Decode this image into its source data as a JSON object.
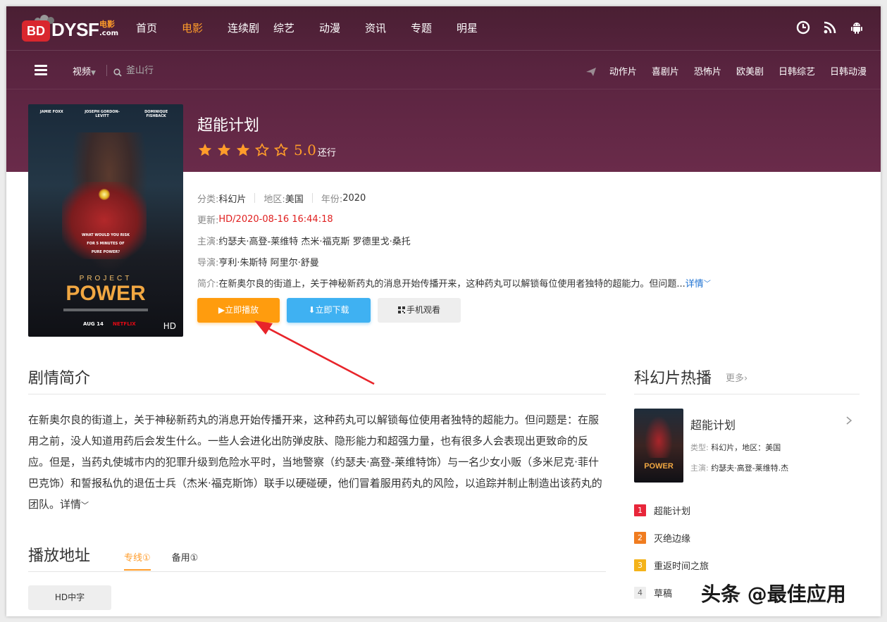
{
  "site": {
    "logo_bd": "BD",
    "logo_name": "DYSF",
    "logo_sub": "电影",
    "logo_domain": ".com"
  },
  "nav": {
    "items": [
      "首页",
      "电影",
      "连续剧",
      "综艺",
      "动漫",
      "资讯",
      "专题",
      "明星"
    ],
    "active_index": 1
  },
  "search": {
    "type_label": "视频",
    "placeholder": "釜山行"
  },
  "quick_links": [
    "动作片",
    "喜剧片",
    "恐怖片",
    "欧美剧",
    "日韩综艺",
    "日韩动漫"
  ],
  "movie": {
    "title": "超能计划",
    "stars_filled": 3,
    "stars_total": 5,
    "score": "5.0",
    "score_label": "还行",
    "poster_badge": "HD",
    "poster_names": [
      "JAMIE FOXX",
      "JOSEPH GORDON-LEVITT",
      "DOMINIQUE FISHBACK"
    ],
    "poster_tagline_1": "WHAT WOULD YOU RISK",
    "poster_tagline_2": "FOR 5 MINUTES OF",
    "poster_tagline_3": "PURE POWER?",
    "poster_project": "PROJECT",
    "poster_power": "POWER",
    "poster_date": "AUG 14",
    "poster_netflix": "NETFLIX",
    "category_label": "分类:",
    "category": "科幻片",
    "region_label": "地区:",
    "region": "美国",
    "year_label": "年份:",
    "year": "2020",
    "update_label": "更新:",
    "update": "HD/2020-08-16 16:44:18",
    "cast_label": "主演:",
    "cast": "约瑟夫·高登-莱维特 杰米·福克斯 罗德里戈·桑托",
    "director_label": "导演:",
    "director": "亨利·朱斯特 阿里尔·舒曼",
    "summary_label": "简介:",
    "summary": "在新奥尔良的街道上，关于神秘新药丸的消息开始传播开来，这种药丸可以解锁每位使用者独特的超能力。但问题...",
    "summary_more": "详情"
  },
  "buttons": {
    "play": "▶立即播放",
    "download": "⬇立即下载",
    "mobile": "手机观看"
  },
  "plot": {
    "title": "剧情简介",
    "text": "在新奥尔良的街道上，关于神秘新药丸的消息开始传播开来，这种药丸可以解锁每位使用者独特的超能力。但问题是：在服用之前，没人知道用药后会发生什么。一些人会进化出防弹皮肤、隐形能力和超强力量，也有很多人会表现出更致命的反应。但是，当药丸使城市内的犯罪升级到危险水平时，当地警察（约瑟夫·高登-莱维特饰）与一名少女小贩（多米尼克·菲什巴克饰）和誓报私仇的退伍士兵（杰米·福克斯饰）联手以硬碰硬，他们冒着服用药丸的风险，以追踪并制止制造出该药丸的团队。",
    "more": "详情"
  },
  "playback": {
    "title": "播放地址",
    "tabs": [
      "专线①",
      "备用①"
    ],
    "active_tab": 0,
    "episodes": [
      "HD中字"
    ]
  },
  "sidebar": {
    "title": "科幻片热播",
    "more": "更多",
    "featured": {
      "name": "超能计划",
      "type_label": "类型:",
      "type": "科幻片，地区：美国",
      "cast_label": "主演:",
      "cast": "约瑟夫·高登-莱维特.杰",
      "thumb_text": "POWER"
    },
    "ranks": [
      {
        "num": "1",
        "name": "超能计划",
        "color": "#e8263a"
      },
      {
        "num": "2",
        "name": "灭绝边缘",
        "color": "#f07c20"
      },
      {
        "num": "3",
        "name": "重返时间之旅",
        "color": "#f4b31a"
      },
      {
        "num": "4",
        "name": "草稿",
        "color": "#eeeeee"
      }
    ]
  },
  "watermark": "头条 @最佳应用",
  "colors": {
    "accent": "#ff9c2a",
    "hero_bg": "#5a2440",
    "play_button": "#ff9c0e",
    "download_button": "#3fb1f2",
    "annotation_arrow": "#e8242a"
  }
}
